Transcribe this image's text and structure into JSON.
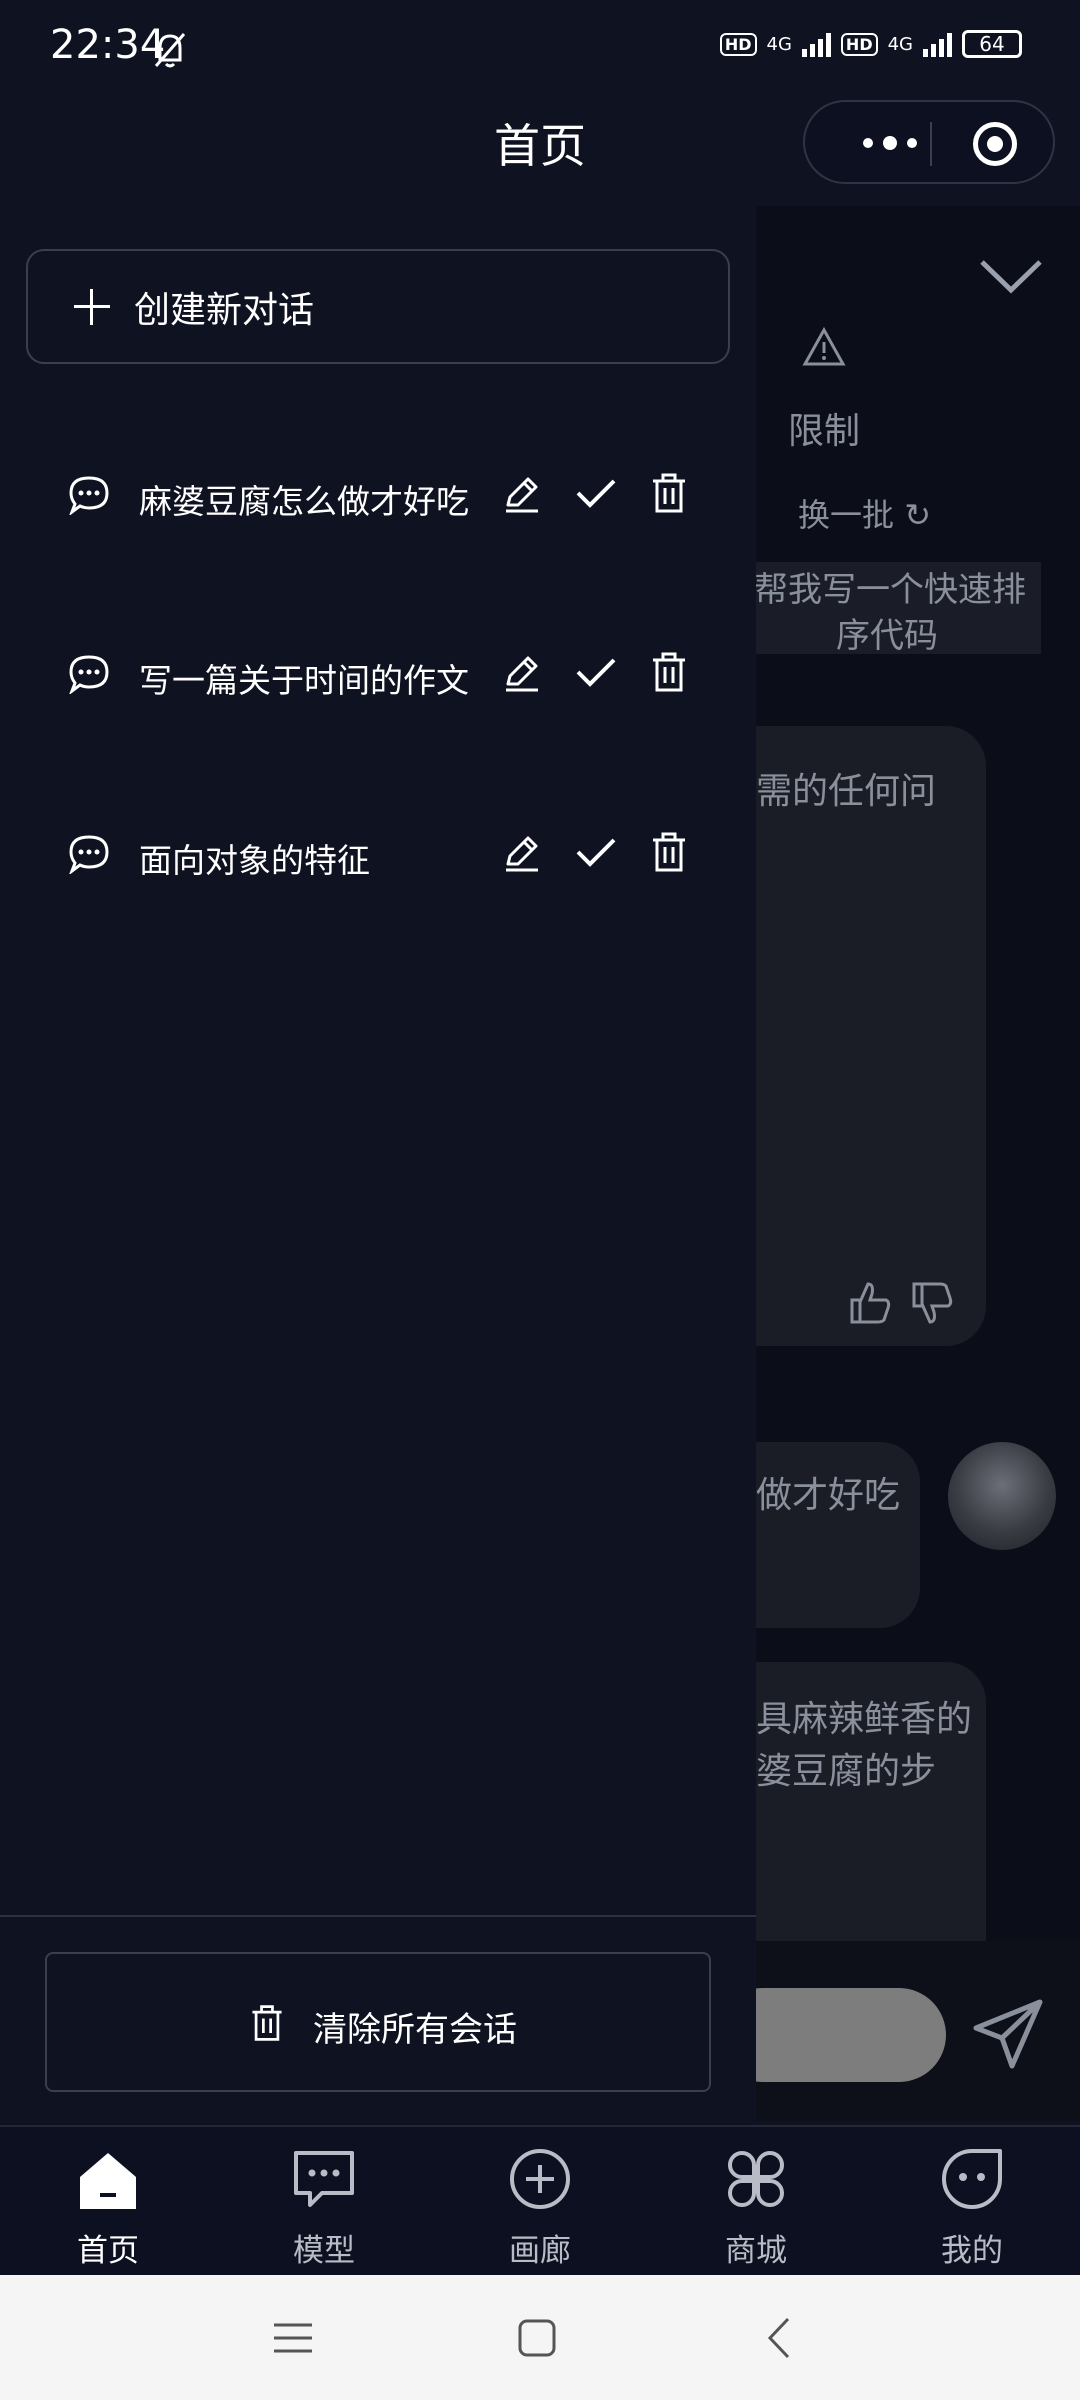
{
  "status": {
    "time": "22:34",
    "net1": "4G",
    "net2": "4G",
    "hd": "HD",
    "battery": "64"
  },
  "header": {
    "title": "首页"
  },
  "drawer": {
    "new_chat_label": "创建新对话",
    "conversations": [
      {
        "title": "麻婆豆腐怎么做才好吃"
      },
      {
        "title": "写一篇关于时间的作文"
      },
      {
        "title": "面向对象的特征"
      }
    ],
    "clear_all_label": "清除所有会话"
  },
  "background_chat": {
    "limit_label": "限制",
    "refresh_label": "换一批",
    "suggestion_line1": "帮我写一个快速排",
    "suggestion_line2": "序代码",
    "reply1_text": "需的任何问",
    "user_msg_text": "做才好吃",
    "reply2_line1": "具麻辣鲜香的",
    "reply2_line2": "婆豆腐的步"
  },
  "tabs": [
    {
      "label": "首页",
      "icon": "home-icon",
      "active": true
    },
    {
      "label": "模型",
      "icon": "chat-bubble-icon"
    },
    {
      "label": "画廊",
      "icon": "plus-circle-icon"
    },
    {
      "label": "商城",
      "icon": "grid-icon"
    },
    {
      "label": "我的",
      "icon": "face-icon"
    }
  ],
  "colors": {
    "background": "#0f1220",
    "panel": "#0b0d18",
    "text": "#ffffff",
    "muted": "#8a8f9c"
  }
}
